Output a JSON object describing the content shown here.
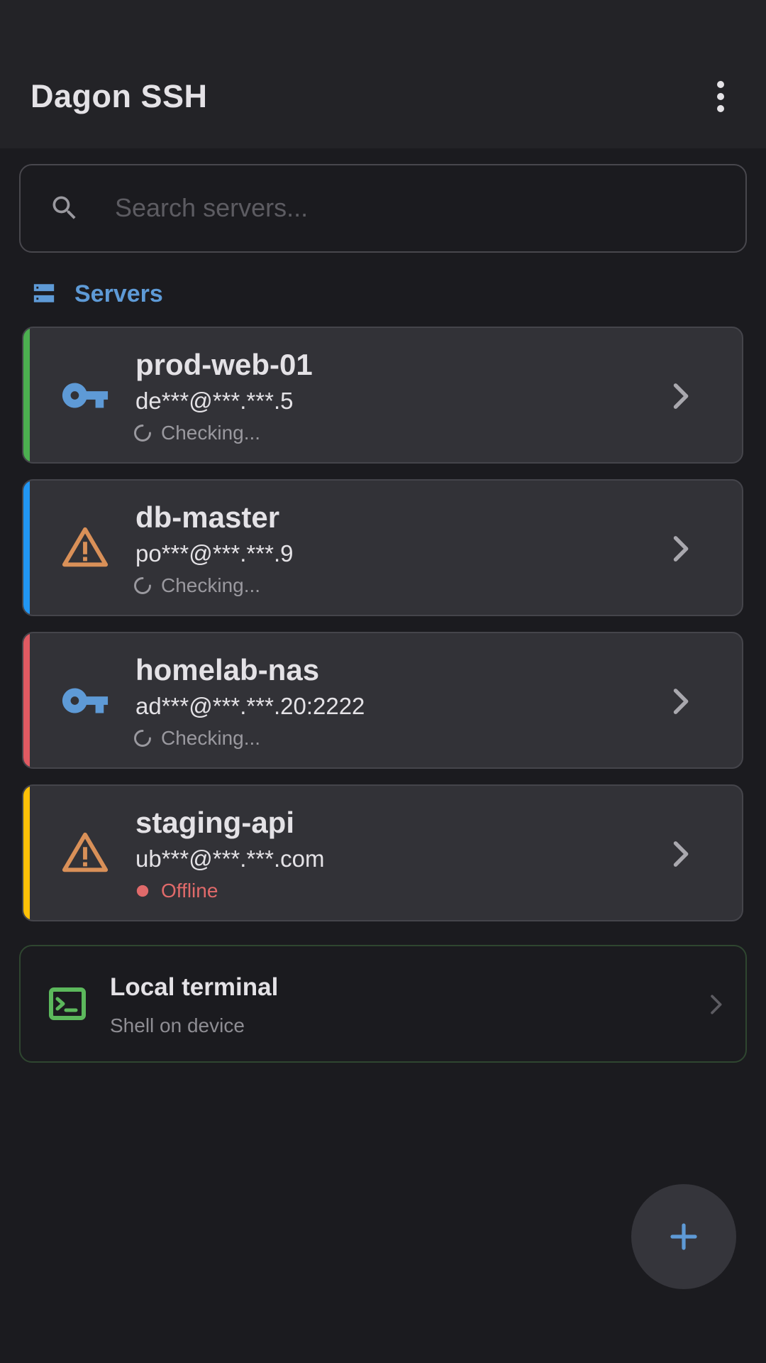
{
  "app": {
    "title": "Dagon SSH"
  },
  "search": {
    "placeholder": "Search servers..."
  },
  "section": {
    "title": "Servers"
  },
  "servers": [
    {
      "name": "prod-web-01",
      "address": "de***@***.***.5",
      "status": "Checking...",
      "status_kind": "checking",
      "auth_icon": "key-icon",
      "accent": "#4caf50"
    },
    {
      "name": "db-master",
      "address": "po***@***.***.9",
      "status": "Checking...",
      "status_kind": "checking",
      "auth_icon": "warning-icon",
      "accent": "#2196f3"
    },
    {
      "name": "homelab-nas",
      "address": "ad***@***.***.20:2222",
      "status": "Checking...",
      "status_kind": "checking",
      "auth_icon": "key-icon",
      "accent": "#e05a62"
    },
    {
      "name": "staging-api",
      "address": "ub***@***.***.com",
      "status": "Offline",
      "status_kind": "offline",
      "auth_icon": "warning-icon",
      "accent": "#ffc107"
    }
  ],
  "local": {
    "title": "Local terminal",
    "subtitle": "Shell on device"
  },
  "colors": {
    "accent_blue": "#5e9ad6",
    "warning_orange": "#d99058",
    "terminal_green": "#5cb85c",
    "offline_red": "#e06a6a"
  },
  "fab": {
    "icon": "plus-icon"
  }
}
